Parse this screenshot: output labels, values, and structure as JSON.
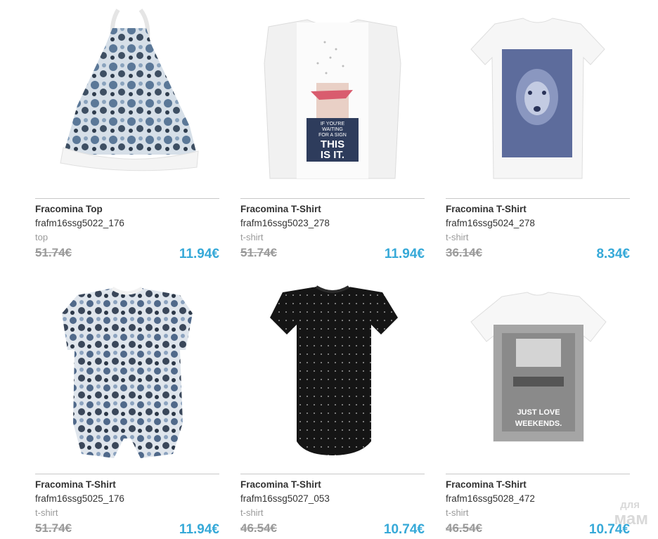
{
  "products": [
    {
      "title": "Fracomina Top",
      "sku": "frafm16ssg5022_176",
      "category": "top",
      "old_price": "51.74€",
      "price": "11.94€",
      "image": "floral-halter-top-image"
    },
    {
      "title": "Fracomina T-Shirt",
      "sku": "frafm16ssg5023_278",
      "category": "t-shirt",
      "old_price": "51.74€",
      "price": "11.94€",
      "image": "white-sleeveless-print-tee-image"
    },
    {
      "title": "Fracomina T-Shirt",
      "sku": "frafm16ssg5024_278",
      "category": "t-shirt",
      "old_price": "36.14€",
      "price": "8.34€",
      "image": "white-photo-print-tee-image"
    },
    {
      "title": "Fracomina T-Shirt",
      "sku": "frafm16ssg5025_176",
      "category": "t-shirt",
      "old_price": "51.74€",
      "price": "11.94€",
      "image": "floral-lace-tee-image"
    },
    {
      "title": "Fracomina T-Shirt",
      "sku": "frafm16ssg5027_053",
      "category": "t-shirt",
      "old_price": "46.54€",
      "price": "10.74€",
      "image": "black-studded-tee-image"
    },
    {
      "title": "Fracomina T-Shirt",
      "sku": "frafm16ssg5028_472",
      "category": "t-shirt",
      "old_price": "46.54€",
      "price": "10.74€",
      "image": "raglan-photo-print-tee-image"
    }
  ],
  "print_text": {
    "p1": "IF YOU'RE",
    "p2": "WAITING",
    "p3": "FOR A SIGN",
    "p4": "THIS",
    "p5": "IS IT.",
    "q1": "JUST LOVE",
    "q2": "WEEKENDS."
  },
  "watermark": {
    "line1": "для",
    "line2": "мам"
  },
  "colors": {
    "price": "#36a9d8",
    "old_price": "#9a9a9a",
    "text": "#333333"
  }
}
